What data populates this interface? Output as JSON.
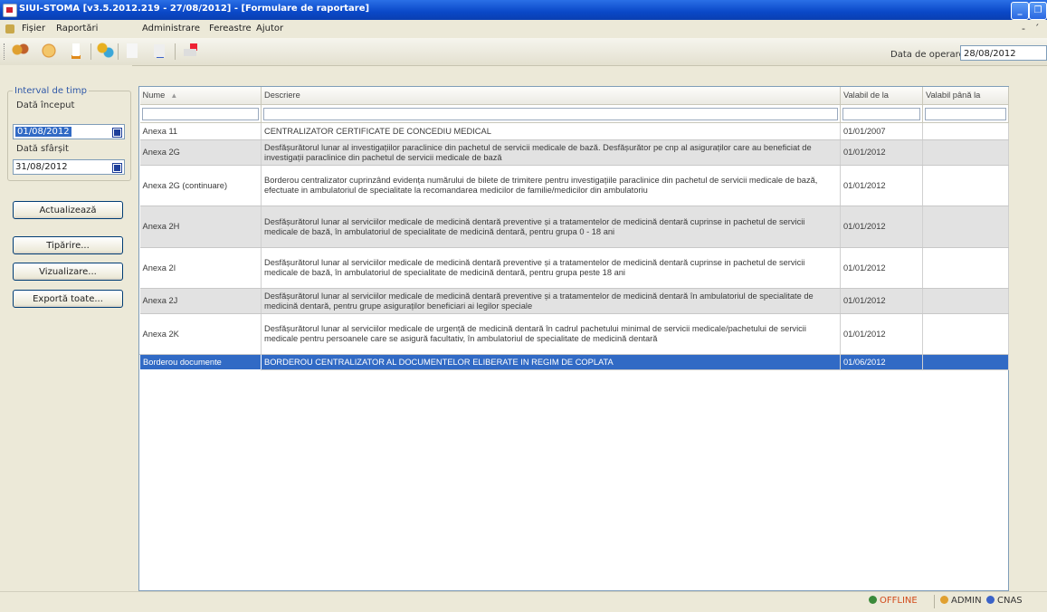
{
  "window": {
    "title": "SIUI-STOMA [v3.5.2012.219 - 27/08/2012] - [Formulare de raportare]",
    "controls": [
      "minimize",
      "restore"
    ]
  },
  "menu": {
    "items": [
      "Fișier",
      "Raportări",
      "Administrare",
      "Fereastre",
      "Ajutor"
    ],
    "mdi_controls": [
      "-",
      "´"
    ]
  },
  "toolbar": {
    "icons": [
      "users-icon",
      "refresh-icon",
      "tooth-icon",
      "patients-icon",
      "report-icon",
      "export-icon",
      "print-icon"
    ],
    "operating_date_label": "Data de operare:",
    "operating_date_value": "28/08/2012"
  },
  "filter": {
    "group_title": "Interval de timp",
    "start_label": "Dată început",
    "start_value": "01/08/2012",
    "end_label": "Dată sfârșit",
    "end_value": "31/08/2012"
  },
  "actions": {
    "refresh": "Actualizează",
    "print": "Tipărire...",
    "preview": "Vizualizare...",
    "export_all": "Exportă toate..."
  },
  "grid": {
    "columns": [
      "Nume",
      "Descriere",
      "Valabil de la",
      "Valabil până la"
    ],
    "rows": [
      {
        "name": "Anexa 11",
        "description": "CENTRALIZATOR CERTIFICATE DE CONCEDIU MEDICAL",
        "valid_from": "01/01/2007",
        "valid_to": ""
      },
      {
        "name": "Anexa 2G",
        "description": "Desfășurătorul lunar al investigațiilor paraclinice din pachetul de servicii medicale de bază. Desfășurător pe cnp al asiguraților care au beneficiat de investigații paraclinice din pachetul de servicii medicale de bază",
        "valid_from": "01/01/2012",
        "valid_to": ""
      },
      {
        "name": "Anexa 2G (continuare)",
        "description": "Borderou centralizator cuprinzând evidența numărului de bilete de trimitere pentru investigațiile paraclinice din pachetul de servicii medicale de bază, efectuate in ambulatoriul de specialitate la recomandarea medicilor de familie/medicilor din ambulatoriu",
        "valid_from": "01/01/2012",
        "valid_to": ""
      },
      {
        "name": "Anexa 2H",
        "description": "Desfășurătorul lunar al serviciilor medicale de medicină dentară preventive și a tratamentelor de medicină dentară cuprinse in pachetul de servicii medicale de bază, în ambulatoriul de specialitate de medicină dentară, pentru grupa 0 - 18 ani",
        "valid_from": "01/01/2012",
        "valid_to": ""
      },
      {
        "name": "Anexa 2I",
        "description": "Desfășurătorul lunar al serviciilor medicale de medicină dentară preventive și a tratamentelor de medicină dentară cuprinse in pachetul de servicii medicale de bază, în ambulatoriul de specialitate de medicină dentară, pentru grupa peste 18 ani",
        "valid_from": "01/01/2012",
        "valid_to": ""
      },
      {
        "name": "Anexa 2J",
        "description": "Desfășurătorul lunar al serviciilor medicale de medicină dentară preventive și a tratamentelor de medicină dentară în ambulatoriul de specialitate de medicină dentară, pentru grupe asiguraților beneficiari ai legilor speciale",
        "valid_from": "01/01/2012",
        "valid_to": ""
      },
      {
        "name": "Anexa 2K",
        "description": "Desfășurătorul lunar al serviciilor medicale de urgență de medicină dentară în cadrul pachetului minimal de servicii medicale/pachetului de servicii medicale pentru persoanele care se asigură facultativ, în ambulatoriul de specialitate de medicină dentară",
        "valid_from": "01/01/2012",
        "valid_to": ""
      },
      {
        "name": "Borderou documente",
        "description": "BORDEROU CENTRALIZATOR AL DOCUMENTELOR ELIBERATE IN REGIM DE COPLATA",
        "valid_from": "01/06/2012",
        "valid_to": ""
      }
    ]
  },
  "status": {
    "connection": "OFFLINE",
    "user": "ADMIN",
    "server": "CNAS"
  }
}
